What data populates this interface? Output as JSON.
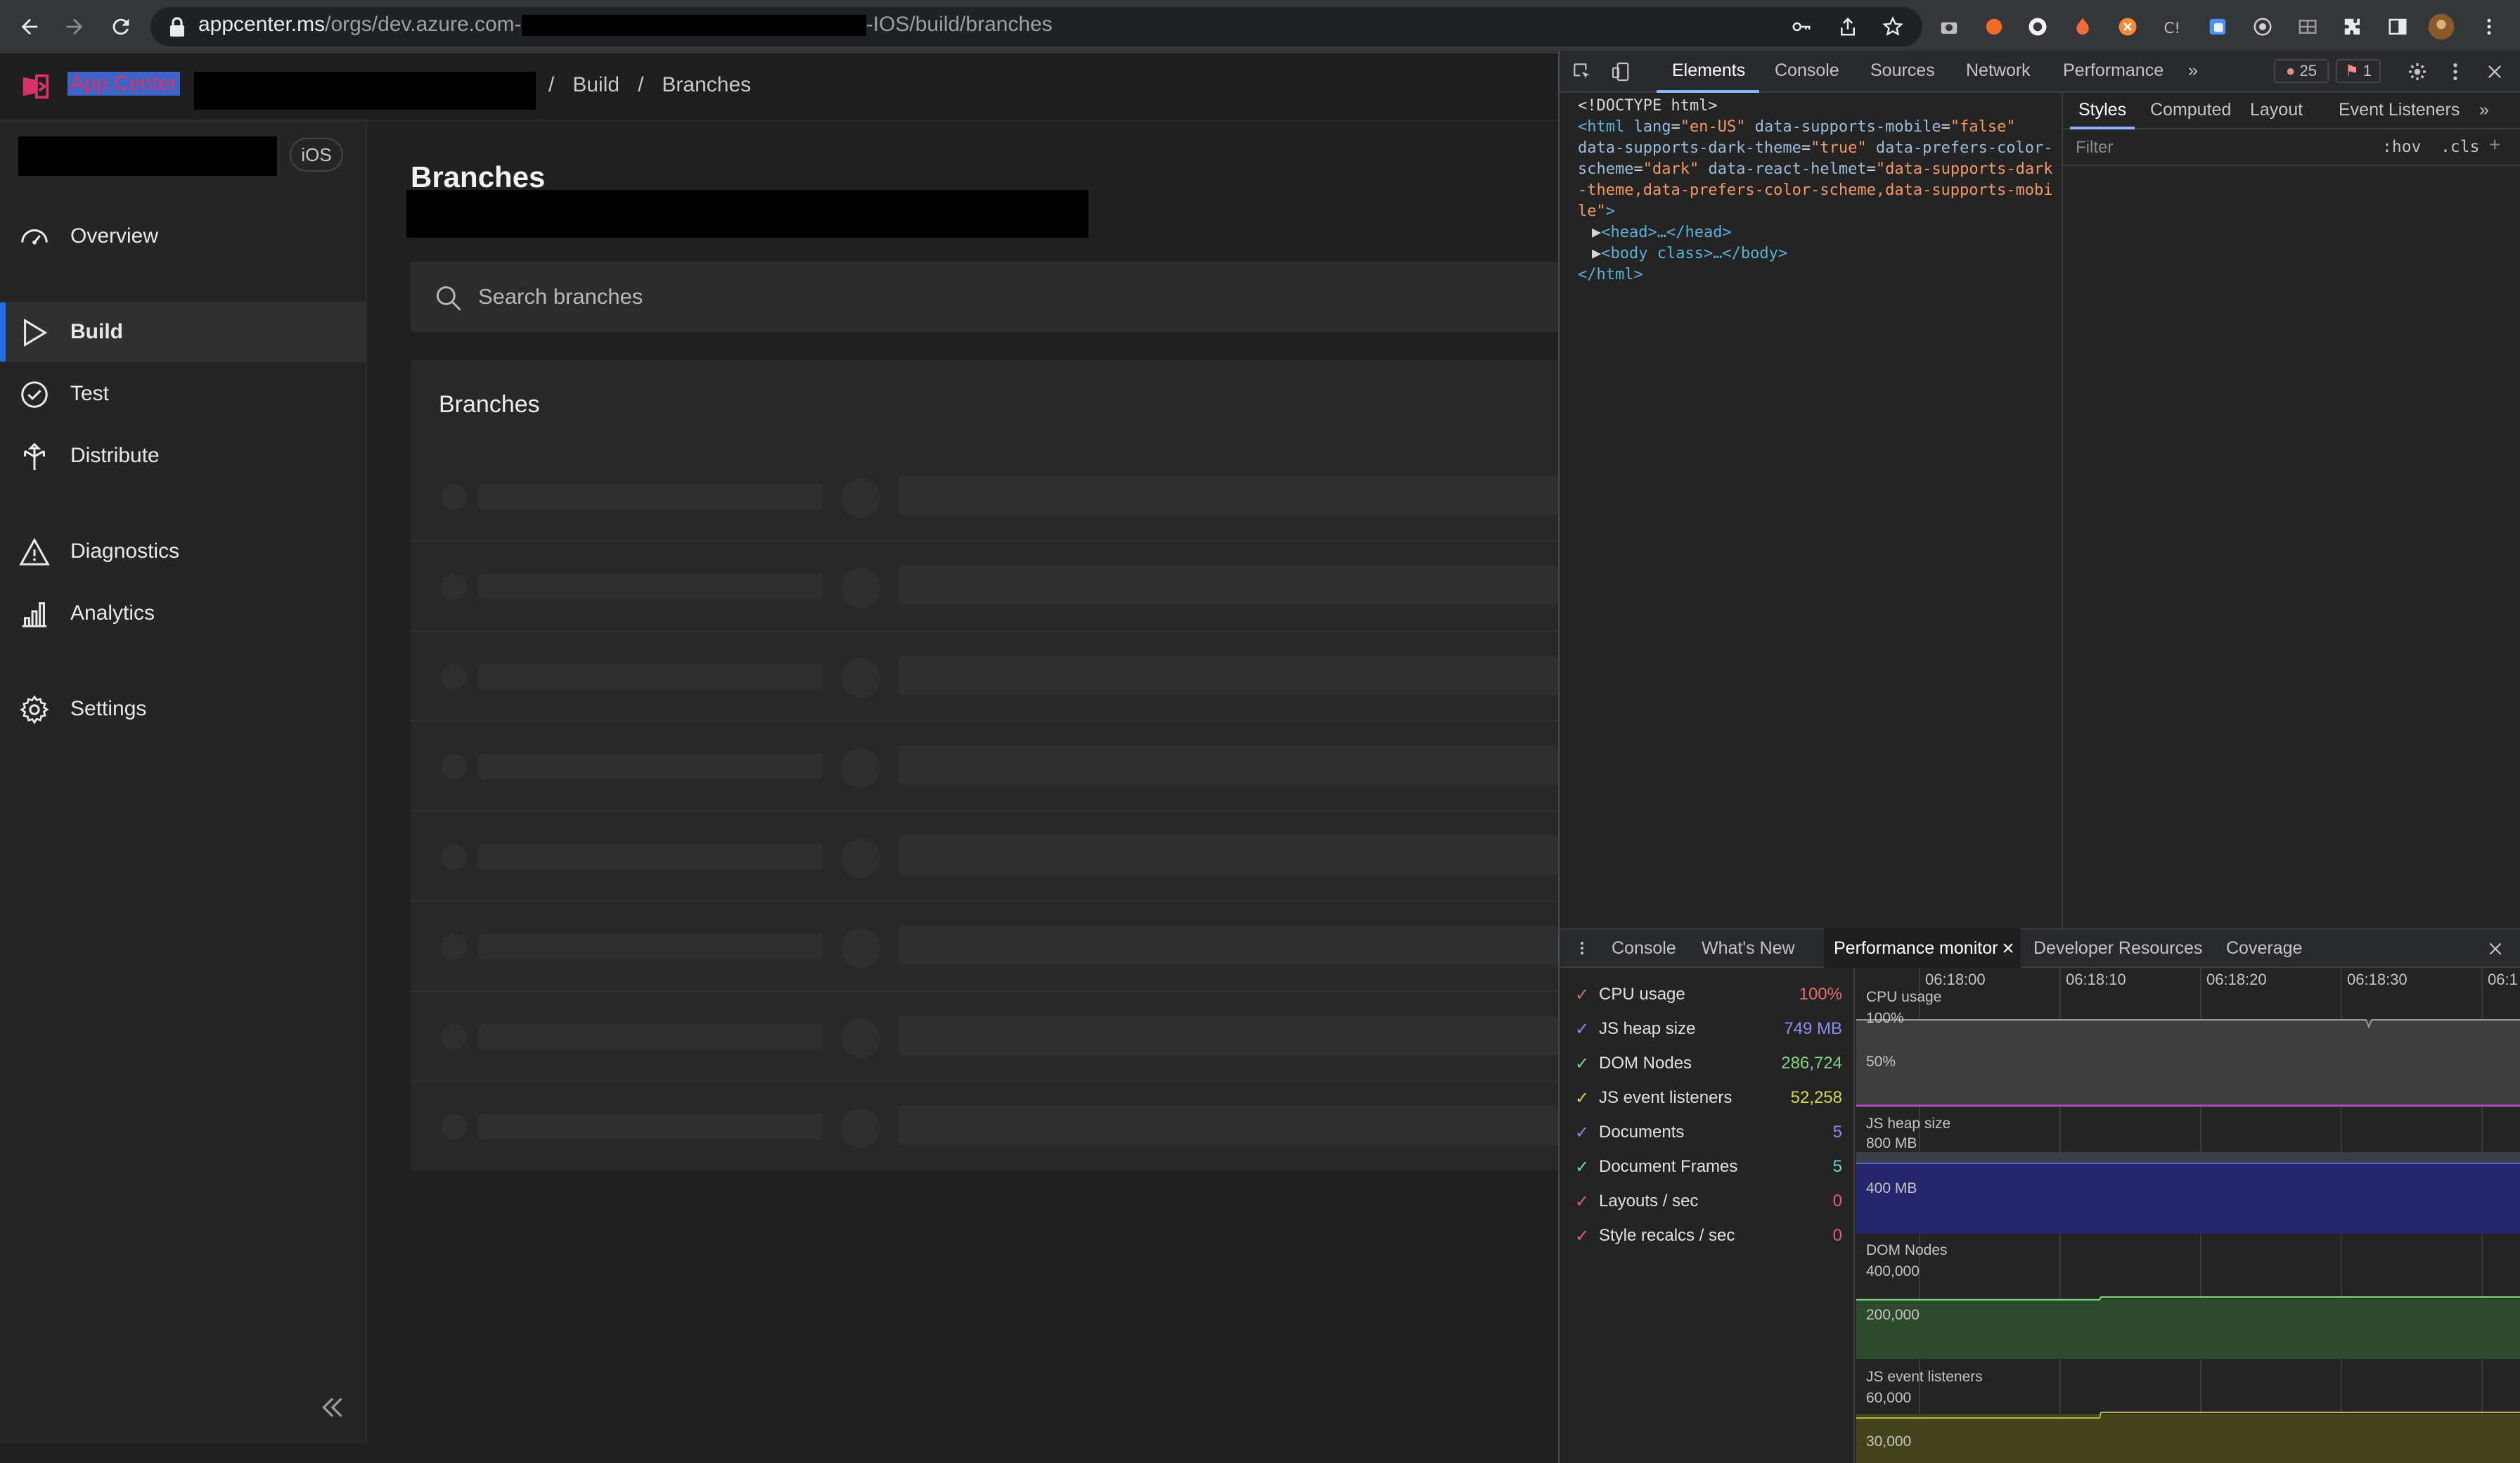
{
  "browser": {
    "url_host": "appcenter.ms",
    "url_path_start": "/orgs/dev.azure.com-",
    "url_path_end": "-IOS/build/branches"
  },
  "app": {
    "logo_text": "App Center",
    "breadcrumb": [
      "/",
      "Build",
      "/",
      "Branches"
    ],
    "os_badge": "iOS"
  },
  "sidebar": {
    "items": [
      {
        "label": "Overview",
        "icon": "overview-icon"
      },
      {
        "label": "Build",
        "icon": "build-play-icon",
        "active": true
      },
      {
        "label": "Test",
        "icon": "test-check-icon"
      },
      {
        "label": "Distribute",
        "icon": "distribute-icon"
      },
      {
        "label": "Diagnostics",
        "icon": "diagnostics-warning-icon"
      },
      {
        "label": "Analytics",
        "icon": "analytics-bar-icon"
      },
      {
        "label": "Settings",
        "icon": "settings-gear-icon"
      }
    ]
  },
  "main": {
    "title": "Branches",
    "search_placeholder": "Search branches",
    "panel_title": "Branches"
  },
  "devtools": {
    "tabs": [
      "Elements",
      "Console",
      "Sources",
      "Network",
      "Performance",
      "»"
    ],
    "errors": "25",
    "warnings": "1",
    "elements_lines": {
      "l1": "<!DOCTYPE html>",
      "head": "<head>…</head>",
      "body": "<body class>…</body>",
      "close": "</html>"
    },
    "html_attrs": {
      "lang": "en-US",
      "mobile": "false",
      "dark": "true",
      "scheme": "dark",
      "helmet": "data-supports-dark-theme,data-prefers-color-scheme,data-supports-mobile"
    },
    "styles_tabs": [
      "Styles",
      "Computed",
      "Layout",
      "Event Listeners",
      "»"
    ],
    "filter_placeholder": "Filter",
    "hov_cls": ":hov  .cls",
    "drawer_tabs": [
      "Console",
      "What's New",
      "Performance monitor",
      "Developer Resources",
      "Coverage"
    ],
    "metrics": [
      {
        "name": "CPU usage",
        "value": "100%",
        "color": "#e46a6a"
      },
      {
        "name": "JS heap size",
        "value": "749 MB",
        "color": "#8c8cf5"
      },
      {
        "name": "DOM Nodes",
        "value": "286,724",
        "color": "#7ed37e"
      },
      {
        "name": "JS event listeners",
        "value": "52,258",
        "color": "#d4d65a"
      },
      {
        "name": "Documents",
        "value": "5",
        "color": "#8c8cf5"
      },
      {
        "name": "Document Frames",
        "value": "5",
        "color": "#6fd3d3"
      },
      {
        "name": "Layouts / sec",
        "value": "0",
        "color": "#e05a9a"
      },
      {
        "name": "Style recalcs / sec",
        "value": "0",
        "color": "#e05a9a"
      }
    ],
    "timeline": [
      "06:18:00",
      "06:18:10",
      "06:18:20",
      "06:18:30",
      "06:1"
    ],
    "graphs": {
      "cpu_title": "CPU usage",
      "cpu_100": "100%",
      "cpu_50": "50%",
      "heap_title": "JS heap size",
      "heap_800": "800 MB",
      "heap_400": "400 MB",
      "dom_title": "DOM Nodes",
      "dom_400k": "400,000",
      "dom_200k": "200,000",
      "ev_title": "JS event listeners",
      "ev_60k": "60,000",
      "ev_30k": "30,000"
    }
  }
}
